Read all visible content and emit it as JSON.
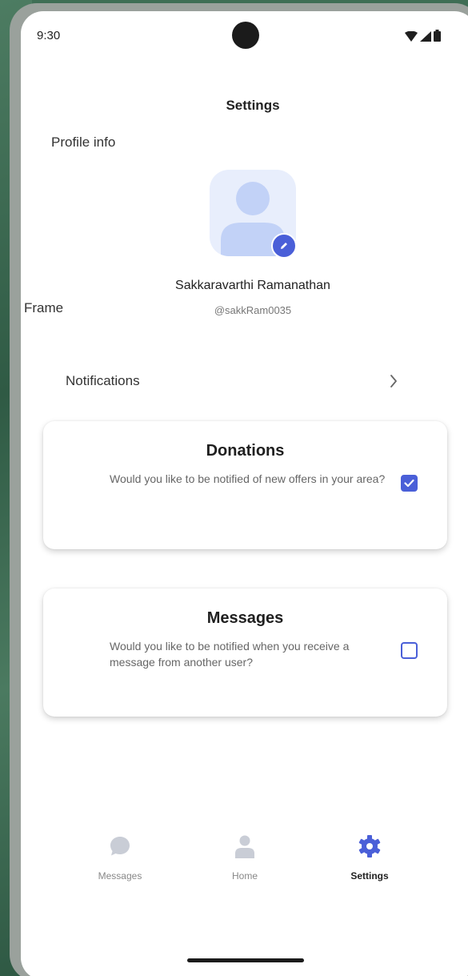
{
  "status_bar": {
    "time": "9:30"
  },
  "header": {
    "title": "Settings"
  },
  "profile": {
    "section_label": "Profile info",
    "frame_label": "Frame",
    "name": "Sakkaravarthi Ramanathan",
    "handle": "@sakkRam0035"
  },
  "notifications": {
    "label": "Notifications",
    "cards": [
      {
        "title": "Donations",
        "description": "Would you like to be notified of new offers in your area?",
        "checked": true
      },
      {
        "title": "Messages",
        "description": "Would you like to be notified when you receive a message from another user?",
        "checked": false
      }
    ]
  },
  "bottom_nav": {
    "items": [
      {
        "label": "Messages",
        "icon": "chat-bubble-icon",
        "active": false
      },
      {
        "label": "Home",
        "icon": "person-icon",
        "active": false
      },
      {
        "label": "Settings",
        "icon": "gear-icon",
        "active": true
      }
    ]
  },
  "colors": {
    "accent": "#4a5fd8",
    "avatar_bg": "#e8eefc",
    "inactive_icon": "#c9cdd6"
  }
}
